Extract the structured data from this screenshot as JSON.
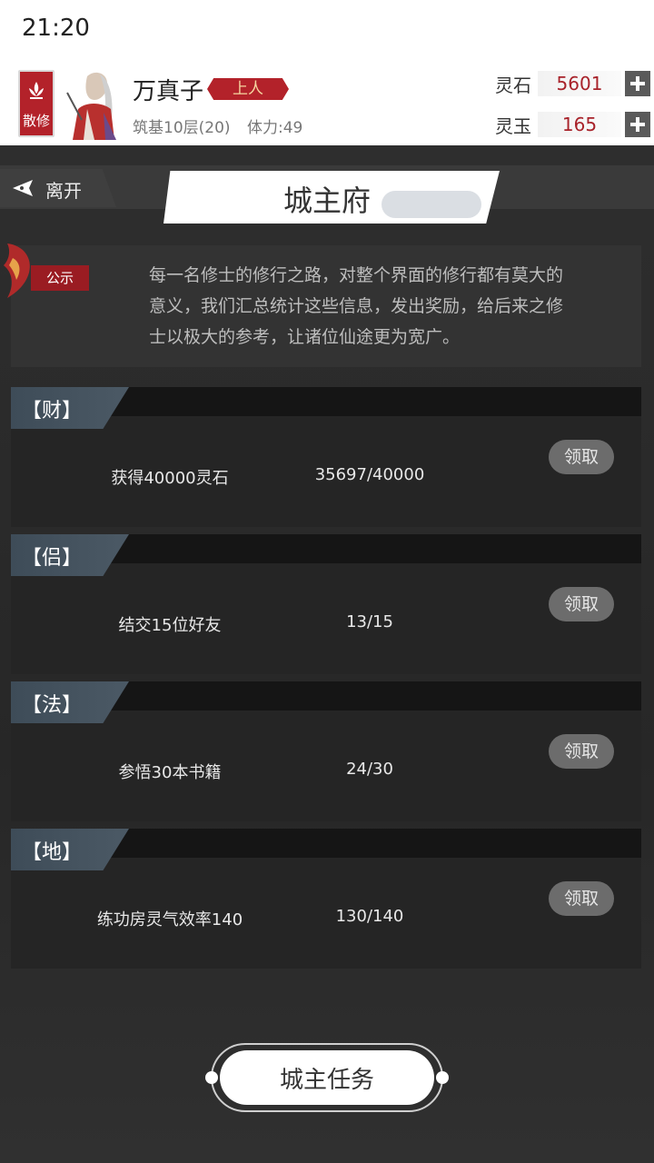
{
  "status_bar": {
    "time": "21:20"
  },
  "player": {
    "sect": "散修",
    "name": "万真子",
    "rank": "上人",
    "realm": "筑基10层(20)",
    "stamina": "体力:49"
  },
  "currencies": [
    {
      "label": "灵石",
      "value": "5601"
    },
    {
      "label": "灵玉",
      "value": "165"
    }
  ],
  "nav": {
    "back_label": "离开",
    "title": "城主府"
  },
  "notice": {
    "tag": "公示",
    "text": "每一名修士的修行之路，对整个界面的修行都有莫大的意义，我们汇总统计这些信息，发出奖励，给后来之修士以极大的参考，让诸位仙途更为宽广。"
  },
  "tasks": [
    {
      "category": "【财】",
      "desc": "获得40000灵石",
      "progress": "35697/40000",
      "button": "领取"
    },
    {
      "category": "【侣】",
      "desc": "结交15位好友",
      "progress": "13/15",
      "button": "领取"
    },
    {
      "category": "【法】",
      "desc": "参悟30本书籍",
      "progress": "24/30",
      "button": "领取"
    },
    {
      "category": "【地】",
      "desc": "练功房灵气效率140",
      "progress": "130/140",
      "button": "领取"
    }
  ],
  "city_task_button": "城主任务",
  "colors": {
    "accent_red": "#b3222a",
    "currency_red": "#a8222a",
    "task_tab": "#46535f"
  }
}
